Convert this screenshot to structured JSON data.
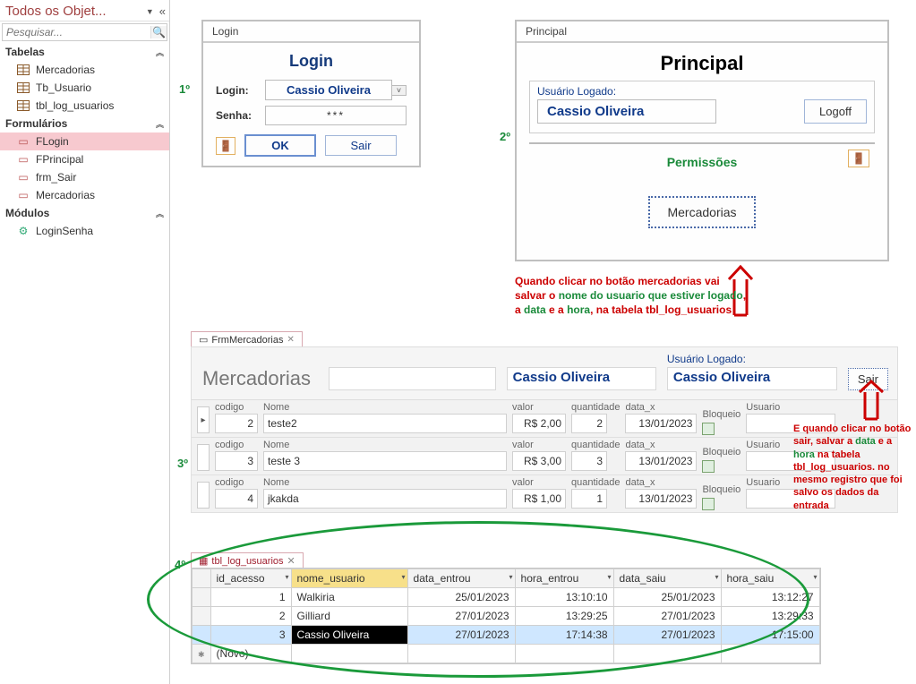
{
  "nav": {
    "title": "Todos os Objet...",
    "search_placeholder": "Pesquisar...",
    "groups": [
      {
        "label": "Tabelas",
        "key": "tabelas"
      },
      {
        "label": "Formulários",
        "key": "forms"
      },
      {
        "label": "Módulos",
        "key": "mods"
      }
    ],
    "tabelas": [
      "Mercadorias",
      "Tb_Usuario",
      "tbl_log_usuarios"
    ],
    "forms": [
      "FLogin",
      "FPrincipal",
      "frm_Sair",
      "Mercadorias"
    ],
    "mods": [
      "LoginSenha"
    ]
  },
  "steps": {
    "s1": "1º",
    "s2": "2º",
    "s3": "3º",
    "s4": "4º"
  },
  "login": {
    "win_title": "Login",
    "header": "Login",
    "lbl_login": "Login:",
    "lbl_senha": "Senha:",
    "val_login": "Cassio Oliveira",
    "val_senha": "***",
    "btn_ok": "OK",
    "btn_sair": "Sair"
  },
  "principal": {
    "win_title": "Principal",
    "header": "Principal",
    "lbl_userlog": "Usuário Logado:",
    "val_userlog": "Cassio Oliveira",
    "btn_logoff": "Logoff",
    "perm_header": "Permissões",
    "btn_merc": "Mercadorias"
  },
  "note_principal_pre": "Quando clicar no botão mercadorias vai salvar o ",
  "note_principal_green1": "nome do usuario que estiver logado",
  "note_principal_mid": ", a ",
  "note_principal_green2": "data",
  "note_principal_mid2": " e a ",
  "note_principal_green3": "hora",
  "note_principal_post": ",  na tabela tbl_log_usuarios",
  "frm_merc": {
    "tab": "FrmMercadorias",
    "title": "Mercadorias",
    "big2": "Cassio Oliveira",
    "ul_lbl": "Usuário Logado:",
    "ul_val": "Cassio Oliveira",
    "btn_sair": "Sair",
    "labels": {
      "codigo": "codigo",
      "nome": "Nome",
      "valor": "valor",
      "qtd": "quantidade",
      "datax": "data_x",
      "blk": "Bloqueio",
      "usr": "Usuario"
    },
    "rows": [
      {
        "codigo": "2",
        "nome": "teste2",
        "valor": "R$ 2,00",
        "qtd": "2",
        "datax": "13/01/2023",
        "usr": ""
      },
      {
        "codigo": "3",
        "nome": "teste 3",
        "valor": "R$ 3,00",
        "qtd": "3",
        "datax": "13/01/2023",
        "usr": ""
      },
      {
        "codigo": "4",
        "nome": "jkakda",
        "valor": "R$ 1,00",
        "qtd": "1",
        "datax": "13/01/2023",
        "usr": ""
      }
    ]
  },
  "note_sair_l1a": "E quando clicar no botão ",
  "note_sair_l1b": "sair",
  "note_sair_l2a": ", salvar a ",
  "note_sair_l2b": "data",
  "note_sair_l2c": " e a ",
  "note_sair_l2d": "hora",
  "note_sair_l3": " na tabela tbl_log_usuarios. no mesmo registro que foi salvo os dados da entrada",
  "log": {
    "tab": "tbl_log_usuarios",
    "cols": [
      "id_acesso",
      "nome_usuario",
      "data_entrou",
      "hora_entrou",
      "data_saiu",
      "hora_saiu"
    ],
    "rows": [
      {
        "id": "1",
        "nome": "Walkiria",
        "de": "25/01/2023",
        "he": "13:10:10",
        "ds": "25/01/2023",
        "hs": "13:12:27"
      },
      {
        "id": "2",
        "nome": "Gilliard",
        "de": "27/01/2023",
        "he": "13:29:25",
        "ds": "27/01/2023",
        "hs": "13:29:33"
      },
      {
        "id": "3",
        "nome": "Cassio Oliveira",
        "de": "27/01/2023",
        "he": "17:14:38",
        "ds": "27/01/2023",
        "hs": "17:15:00"
      }
    ],
    "new_row": "(Novo)"
  }
}
